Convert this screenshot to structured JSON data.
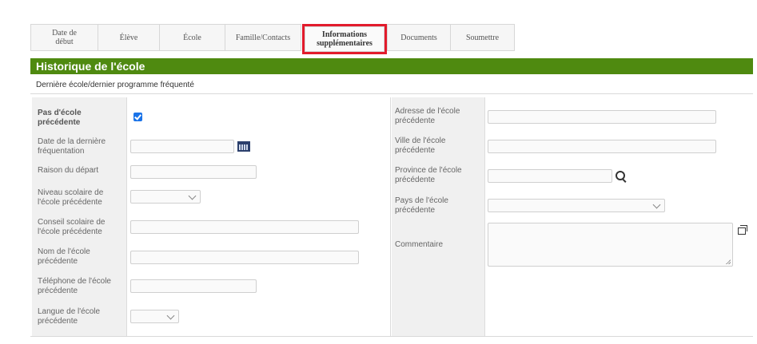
{
  "tabs": [
    {
      "label_line1": "Date de",
      "label_line2": "début"
    },
    {
      "label": "Élève"
    },
    {
      "label": "École"
    },
    {
      "label": "Famille/Contacts"
    },
    {
      "label_line1": "Informations",
      "label_line2": "supplémentaires"
    },
    {
      "label": "Documents"
    },
    {
      "label": "Soumettre"
    }
  ],
  "section": {
    "title": "Historique de l'école",
    "subtitle": "Dernière école/dernier programme fréquenté"
  },
  "left_fields": [
    {
      "label_line1": "Pas d'école",
      "label_line2": "précédente"
    },
    {
      "label_line1": "Date de la dernière",
      "label_line2": "fréquentation"
    },
    {
      "label": "Raison du départ"
    },
    {
      "label_line1": "Niveau scolaire de",
      "label_line2": "l'école précédente"
    },
    {
      "label_line1": "Conseil scolaire de",
      "label_line2": "l'école précédente"
    },
    {
      "label_line1": "Nom de l'école",
      "label_line2": "précédente"
    },
    {
      "label_line1": "Téléphone de l'école",
      "label_line2": "précédente"
    },
    {
      "label_line1": "Langue de l'école",
      "label_line2": "précédente"
    }
  ],
  "right_fields": [
    {
      "label_line1": "Adresse de l'école",
      "label_line2": "précédente"
    },
    {
      "label_line1": "Ville de l'école",
      "label_line2": "précédente"
    },
    {
      "label_line1": "Province de l'école",
      "label_line2": "précédente"
    },
    {
      "label_line1": "Pays de l'école",
      "label_line2": "précédente"
    },
    {
      "label": "Commentaire"
    }
  ],
  "state": {
    "no_previous_school_checked": true
  },
  "icons": {
    "calendar": "calendar-icon",
    "search": "search-icon",
    "popout": "popout-icon",
    "chevron": "chevron-down-icon"
  },
  "colors": {
    "header_green": "#4f8a10",
    "active_tab_highlight": "#e21b2c",
    "checkbox_blue": "#1a73e8"
  }
}
